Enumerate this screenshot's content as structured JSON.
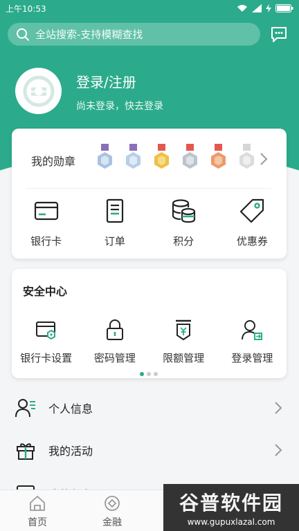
{
  "status_bar": {
    "time": "上午10:53"
  },
  "search": {
    "placeholder": "全站搜索-支持模糊查找"
  },
  "profile": {
    "title": "登录/注册",
    "subtitle": "尚未登录，快去登录"
  },
  "medals": {
    "label": "我的勋章"
  },
  "wallet": {
    "items": [
      {
        "label": "银行卡",
        "icon": "bank-card-icon"
      },
      {
        "label": "订单",
        "icon": "order-icon"
      },
      {
        "label": "积分",
        "icon": "points-icon"
      },
      {
        "label": "优惠券",
        "icon": "coupon-icon"
      }
    ]
  },
  "security": {
    "title": "安全中心",
    "items": [
      {
        "label": "银行卡设置",
        "icon": "card-settings-icon"
      },
      {
        "label": "密码管理",
        "icon": "lock-icon"
      },
      {
        "label": "限额管理",
        "icon": "limit-icon"
      },
      {
        "label": "登录管理",
        "icon": "login-user-icon"
      }
    ],
    "page_indicator": {
      "current": 1,
      "total": 3
    }
  },
  "menu": {
    "items": [
      {
        "label": "个人信息",
        "icon": "user-info-icon"
      },
      {
        "label": "我的活动",
        "icon": "gift-icon"
      },
      {
        "label": "我的任务",
        "icon": "task-icon"
      }
    ]
  },
  "bottom_nav": {
    "items": [
      {
        "label": "首页",
        "icon": "home-icon"
      },
      {
        "label": "金融",
        "icon": "finance-icon"
      }
    ]
  },
  "watermark": {
    "logo": "谷普软件园",
    "url": "www.gupuxlazal.com"
  },
  "colors": {
    "primary": "#2bab8b",
    "background": "#f4f5f6"
  }
}
